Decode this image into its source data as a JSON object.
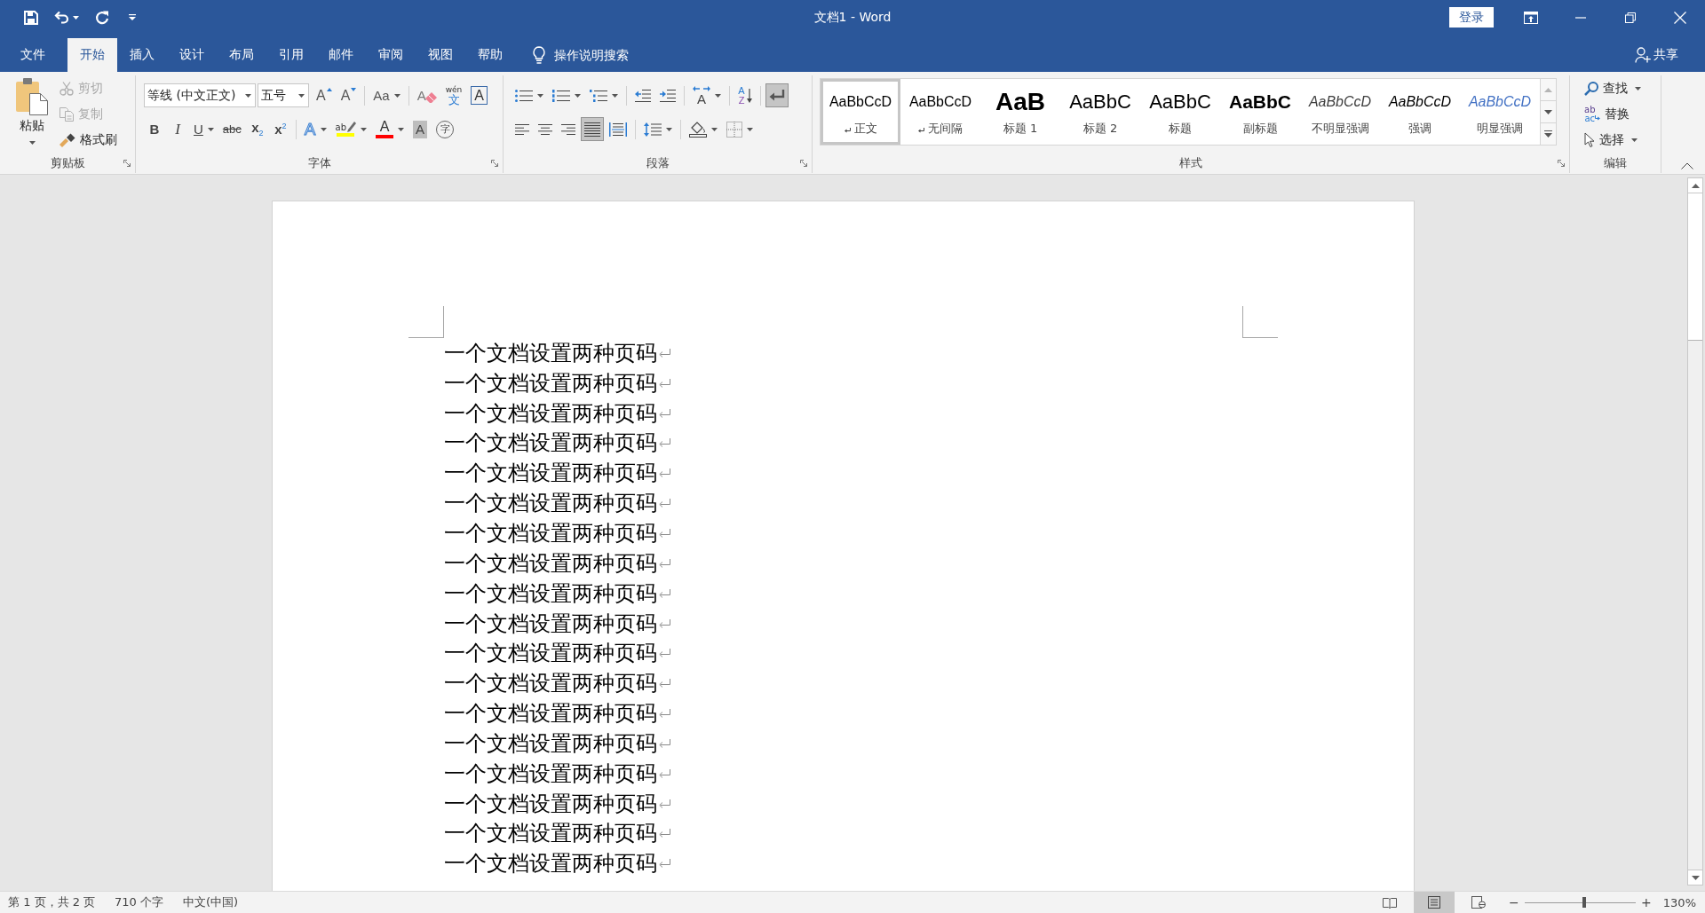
{
  "title_bar": {
    "quick_access": [
      {
        "kind": "save"
      },
      {
        "kind": "undo",
        "dropdown": true
      },
      {
        "kind": "redo"
      },
      {
        "kind": "customize"
      }
    ],
    "title": "文档1 - Word",
    "sign_in": "登录",
    "window_controls": [
      {
        "kind": "ribbon-options"
      },
      {
        "kind": "minimize"
      },
      {
        "kind": "restore"
      },
      {
        "kind": "close"
      }
    ]
  },
  "tabs": [
    {
      "label": "文件",
      "selected": false
    },
    {
      "label": "开始",
      "selected": true
    },
    {
      "label": "插入",
      "selected": false
    },
    {
      "label": "设计",
      "selected": false
    },
    {
      "label": "布局",
      "selected": false
    },
    {
      "label": "引用",
      "selected": false
    },
    {
      "label": "邮件",
      "selected": false
    },
    {
      "label": "审阅",
      "selected": false
    },
    {
      "label": "视图",
      "selected": false
    },
    {
      "label": "帮助",
      "selected": false
    }
  ],
  "tell_me": {
    "placeholder": "操作说明搜索"
  },
  "share": "共享",
  "clipboard": {
    "label": "剪贴板",
    "paste": "粘贴",
    "buttons": [
      {
        "kind": "cut",
        "label": "剪切",
        "disabled": true
      },
      {
        "kind": "copy",
        "label": "复制",
        "disabled": true
      },
      {
        "kind": "format-painter",
        "label": "格式刷",
        "disabled": false
      }
    ]
  },
  "font": {
    "label": "字体",
    "font_name": "等线 (中文正文)",
    "font_size": "五号",
    "row_1": [
      [
        {
          "kind": "grow",
          "text": "A"
        },
        {
          "kind": "shrink",
          "text": "A"
        }
      ],
      [
        {
          "kind": "case",
          "text": "Aa",
          "dropdown": true
        }
      ],
      [
        {
          "kind": "clear",
          "text": "A"
        },
        {
          "kind": "pinyin",
          "text": "wén",
          "text_2": "文"
        },
        {
          "kind": "char-border",
          "text": "A"
        }
      ]
    ],
    "row_2": [
      [
        {
          "kind": "bold",
          "text": "B",
          "on": false
        },
        {
          "kind": "italic",
          "text": "I",
          "on": false
        },
        {
          "kind": "underline",
          "text": "U",
          "on": false,
          "dropdown": true
        },
        {
          "kind": "strike",
          "text": "abc",
          "on": false
        },
        {
          "kind": "subscript",
          "text": "x$_{2}$",
          "on": false
        },
        {
          "kind": "superscript",
          "text": "x$^{2}$",
          "on": false
        }
      ],
      [
        {
          "kind": "effects",
          "text": "A",
          "dropdown": true
        },
        {
          "kind": "highlight",
          "text": "ab",
          "color": "#ffff00",
          "dropdown": true
        },
        {
          "kind": "font-color",
          "text": "A",
          "color": "#ff0000",
          "dropdown": true
        },
        {
          "kind": "shading",
          "text": "A"
        },
        {
          "kind": "enclose",
          "text": "字"
        }
      ]
    ]
  },
  "paragraph": {
    "label": "段落",
    "row_1": [
      [
        {
          "kind": "bullets",
          "dropdown": true
        },
        {
          "kind": "numbering",
          "dropdown": true
        },
        {
          "kind": "multilevel",
          "dropdown": true
        }
      ],
      [
        {
          "kind": "outdent"
        },
        {
          "kind": "indent"
        }
      ],
      [
        {
          "kind": "asian-layout",
          "text": "A",
          "dropdown": true
        }
      ],
      [
        {
          "kind": "sort",
          "text": "A",
          "text_2": "Z"
        }
      ],
      [
        {
          "kind": "show-marks",
          "on": true
        }
      ]
    ],
    "row_2": [
      [
        {
          "kind": "align-left",
          "selected": false
        },
        {
          "kind": "align-center",
          "selected": false
        },
        {
          "kind": "align-right",
          "selected": false
        },
        {
          "kind": "justify",
          "selected": true
        },
        {
          "kind": "distribute",
          "selected": false
        }
      ],
      [
        {
          "kind": "line-spacing",
          "dropdown": true
        }
      ],
      [
        {
          "kind": "fill",
          "dropdown": true
        },
        {
          "kind": "borders",
          "dropdown": true
        }
      ]
    ]
  },
  "styles": {
    "label": "样式",
    "items": [
      {
        "kind": "body",
        "preview": "AaBbCcD",
        "label": "正文",
        "selected": true
      },
      {
        "kind": "no-spacing",
        "preview": "AaBbCcD",
        "label": "无间隔",
        "selected": false
      },
      {
        "kind": "heading1",
        "preview": "AaB",
        "label": "标题 1",
        "selected": false
      },
      {
        "kind": "heading2",
        "preview": "AaBbC",
        "label": "标题 2",
        "selected": false
      },
      {
        "kind": "title",
        "preview": "AaBbC",
        "label": "标题",
        "selected": false
      },
      {
        "kind": "subtitle",
        "preview": "AaBbC",
        "label": "副标题",
        "selected": false
      },
      {
        "kind": "subtle-emphasis",
        "preview": "AaBbCcD",
        "label": "不明显强调",
        "selected": false
      },
      {
        "kind": "emphasis",
        "preview": "AaBbCcD",
        "label": "强调",
        "selected": false
      },
      {
        "kind": "intense-emphasis",
        "preview": "AaBbCcD",
        "label": "明显强调",
        "selected": false
      }
    ]
  },
  "editing": {
    "label": "编辑",
    "items": [
      {
        "kind": "find",
        "label": "查找",
        "dropdown": true
      },
      {
        "kind": "replace",
        "label": "替换",
        "text": "ab",
        "text_2": "ac"
      },
      {
        "kind": "select",
        "label": "选择",
        "dropdown": true
      }
    ]
  },
  "document": {
    "lines": [
      "一个文档设置两种页码",
      "一个文档设置两种页码",
      "一个文档设置两种页码",
      "一个文档设置两种页码",
      "一个文档设置两种页码",
      "一个文档设置两种页码",
      "一个文档设置两种页码",
      "一个文档设置两种页码",
      "一个文档设置两种页码",
      "一个文档设置两种页码",
      "一个文档设置两种页码",
      "一个文档设置两种页码",
      "一个文档设置两种页码",
      "一个文档设置两种页码",
      "一个文档设置两种页码",
      "一个文档设置两种页码",
      "一个文档设置两种页码",
      "一个文档设置两种页码"
    ]
  },
  "status_bar": {
    "page": "第 1 页，共 2 页",
    "words": "710 个字",
    "language": "中文(中国)",
    "views": [
      {
        "kind": "read",
        "selected": false
      },
      {
        "kind": "print",
        "selected": true
      },
      {
        "kind": "web",
        "selected": false
      }
    ],
    "zoom": {
      "minus": "−",
      "level": 0.54,
      "plus": "+",
      "reading": "130%"
    }
  }
}
